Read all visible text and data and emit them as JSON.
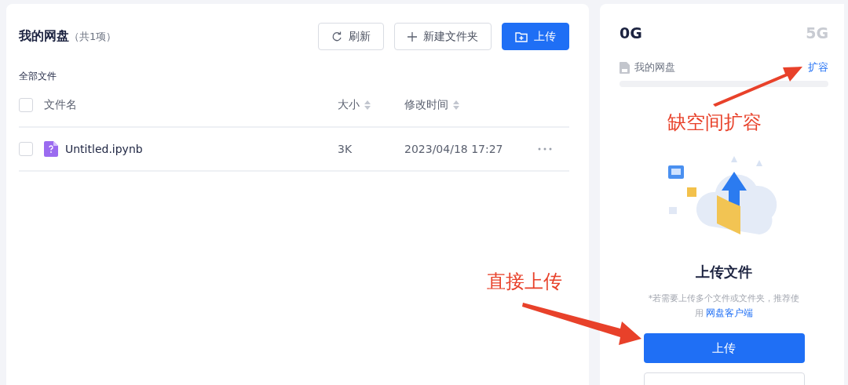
{
  "files_panel": {
    "title": "我的网盘",
    "count": "（共1项）",
    "buttons": [
      {
        "kind": "refresh",
        "label": "刷新"
      },
      {
        "kind": "new-folder",
        "label": "新建文件夹"
      },
      {
        "kind": "upload",
        "label": "上传"
      }
    ],
    "breadcrumb": "全部文件",
    "select_all_checked": false,
    "columns": [
      {
        "label": "文件名",
        "sortable": false
      },
      {
        "label": "大小",
        "sortable": true
      },
      {
        "label": "修改时间",
        "sortable": true
      }
    ],
    "rows": [
      {
        "name": "Untitled.ipynb",
        "size": "3K",
        "modified": "2023/04/18 17:27",
        "checked": false
      }
    ]
  },
  "storage": {
    "used": "0G",
    "total": "5G",
    "label": "我的网盘",
    "expand_link": "扩容",
    "level": 0
  },
  "upload_card": {
    "title": "上传文件",
    "hint": "*若需要上传多个文件或文件夹，推荐使用",
    "client_link": "网盘客户端",
    "button": "上传"
  },
  "annotations": [
    {
      "text": "缺空间扩容"
    },
    {
      "text": "直接上传"
    }
  ]
}
